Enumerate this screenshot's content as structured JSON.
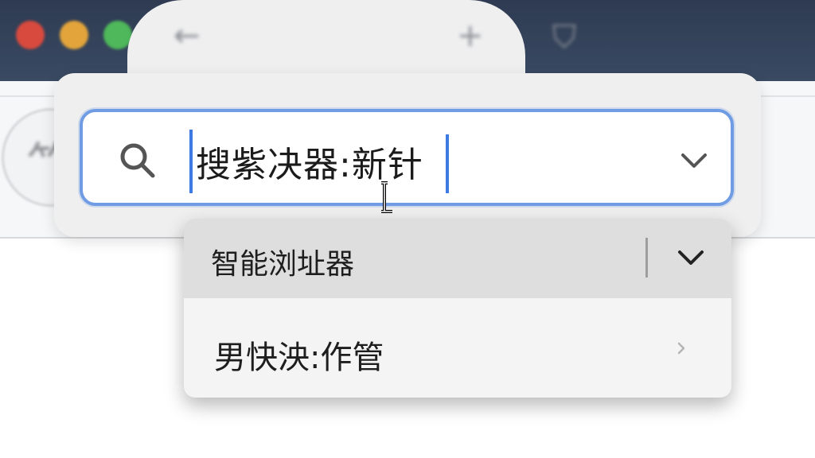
{
  "window": {
    "traffic_lights": [
      "close",
      "minimize",
      "maximize"
    ],
    "colors": {
      "close": "#d84a3e",
      "minimize": "#e3a53b",
      "maximize": "#4fb85a",
      "titlebar": "#34435b"
    }
  },
  "toolbar": {
    "icons": [
      "back-arrow-icon",
      "new-tab-plus-icon",
      "shield-icon"
    ]
  },
  "search": {
    "value": "搜紫决器:新针",
    "icon": "search-icon",
    "accent_color": "#6f9ce3"
  },
  "menu": {
    "items": [
      {
        "label": "智能浏址器",
        "highlighted": true,
        "icon": "chevron-down-icon"
      },
      {
        "label": "男快泱:作管",
        "highlighted": false,
        "icon": "chevron-right-icon"
      }
    ]
  }
}
